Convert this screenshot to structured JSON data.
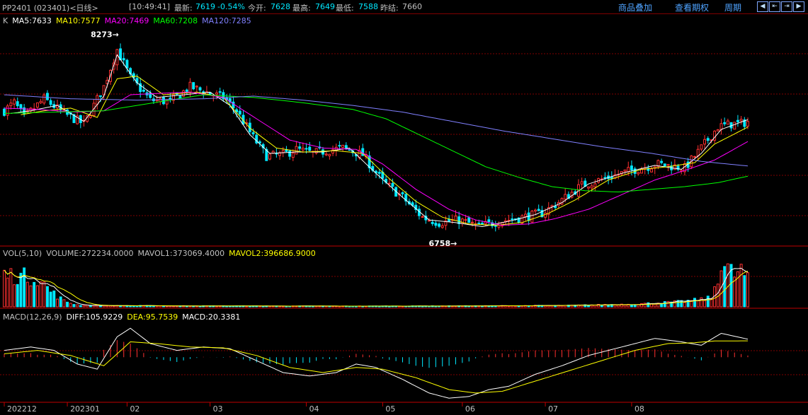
{
  "header": {
    "symbol": "PP2401 (023401)<日线>",
    "time": "[10:49:41]",
    "last_label": "最新:",
    "last_value": "7619",
    "change": "-0.54%",
    "open_label": "今开:",
    "open_value": "7628",
    "high_label": "最高:",
    "high_value": "7649",
    "low_label": "最低:",
    "low_value": "7588",
    "prev_label": "昨结:",
    "prev_value": "7660",
    "buttons": [
      "商品叠加",
      "查看期权",
      "周期"
    ]
  },
  "colors": {
    "up": "#ff3030",
    "down": "#00e8ff",
    "ma5": "#ffffff",
    "ma10": "#ffff00",
    "ma20": "#ff00ff",
    "ma60": "#00ff00",
    "ma120": "#8080ff",
    "grid": "#800000"
  },
  "chart_data": [
    {
      "type": "candlestick",
      "panel": "price",
      "legend": [
        {
          "key": "K",
          "text": "K",
          "color": "#c0c0c0"
        },
        {
          "key": "ma5",
          "text": "MA5:7633",
          "color": "#ffffff"
        },
        {
          "key": "ma10",
          "text": "MA10:7577",
          "color": "#ffff00"
        },
        {
          "key": "ma20",
          "text": "MA20:7469",
          "color": "#ff00ff"
        },
        {
          "key": "ma60",
          "text": "MA60:7208",
          "color": "#00ff00"
        },
        {
          "key": "ma120",
          "text": "MA120:7285",
          "color": "#8080ff"
        }
      ],
      "annotations": [
        {
          "text": "8273",
          "price": 8273
        },
        {
          "text": "6758",
          "price": 6758
        }
      ],
      "ylim": [
        6700,
        8330
      ],
      "close_anchors": [
        [
          0,
          7700
        ],
        [
          3,
          7760
        ],
        [
          6,
          7650
        ],
        [
          12,
          7790
        ],
        [
          18,
          7680
        ],
        [
          24,
          7600
        ],
        [
          30,
          7880
        ],
        [
          34,
          8160
        ],
        [
          38,
          7950
        ],
        [
          44,
          7780
        ],
        [
          50,
          7770
        ],
        [
          56,
          7880
        ],
        [
          62,
          7830
        ],
        [
          66,
          7800
        ],
        [
          70,
          7700
        ],
        [
          75,
          7500
        ],
        [
          79,
          7360
        ],
        [
          84,
          7370
        ],
        [
          88,
          7410
        ],
        [
          93,
          7380
        ],
        [
          97,
          7400
        ],
        [
          102,
          7420
        ],
        [
          108,
          7370
        ],
        [
          114,
          7170
        ],
        [
          120,
          7050
        ],
        [
          126,
          6900
        ],
        [
          131,
          6860
        ],
        [
          137,
          6880
        ],
        [
          143,
          6830
        ],
        [
          149,
          6870
        ],
        [
          156,
          6900
        ],
        [
          162,
          6930
        ],
        [
          168,
          7030
        ],
        [
          174,
          7140
        ],
        [
          182,
          7200
        ],
        [
          190,
          7260
        ],
        [
          197,
          7300
        ],
        [
          205,
          7270
        ],
        [
          210,
          7420
        ],
        [
          215,
          7580
        ],
        [
          219,
          7600
        ],
        [
          222,
          7605
        ],
        [
          224,
          7619
        ]
      ],
      "ma_anchors": {
        "ma5": [
          [
            2,
            7680
          ],
          [
            8,
            7700
          ],
          [
            16,
            7740
          ],
          [
            24,
            7620
          ],
          [
            30,
            7810
          ],
          [
            34,
            8120
          ],
          [
            40,
            7910
          ],
          [
            46,
            7800
          ],
          [
            54,
            7820
          ],
          [
            62,
            7840
          ],
          [
            68,
            7740
          ],
          [
            74,
            7520
          ],
          [
            80,
            7380
          ],
          [
            88,
            7390
          ],
          [
            96,
            7390
          ],
          [
            104,
            7420
          ],
          [
            112,
            7230
          ],
          [
            120,
            7050
          ],
          [
            128,
            6880
          ],
          [
            136,
            6860
          ],
          [
            144,
            6830
          ],
          [
            152,
            6870
          ],
          [
            160,
            6920
          ],
          [
            168,
            7010
          ],
          [
            176,
            7150
          ],
          [
            186,
            7230
          ],
          [
            196,
            7290
          ],
          [
            204,
            7260
          ],
          [
            210,
            7380
          ],
          [
            216,
            7560
          ],
          [
            224,
            7633
          ]
        ],
        "ma10": [
          [
            5,
            7670
          ],
          [
            12,
            7700
          ],
          [
            20,
            7720
          ],
          [
            28,
            7650
          ],
          [
            34,
            7940
          ],
          [
            40,
            7960
          ],
          [
            48,
            7820
          ],
          [
            58,
            7840
          ],
          [
            66,
            7800
          ],
          [
            74,
            7570
          ],
          [
            82,
            7420
          ],
          [
            90,
            7390
          ],
          [
            100,
            7400
          ],
          [
            108,
            7380
          ],
          [
            116,
            7190
          ],
          [
            124,
            7020
          ],
          [
            132,
            6900
          ],
          [
            140,
            6850
          ],
          [
            148,
            6840
          ],
          [
            156,
            6860
          ],
          [
            164,
            6930
          ],
          [
            172,
            7030
          ],
          [
            182,
            7180
          ],
          [
            192,
            7260
          ],
          [
            200,
            7280
          ],
          [
            208,
            7310
          ],
          [
            214,
            7450
          ],
          [
            224,
            7577
          ]
        ],
        "ma20": [
          [
            0,
            7720
          ],
          [
            10,
            7710
          ],
          [
            22,
            7690
          ],
          [
            30,
            7700
          ],
          [
            38,
            7820
          ],
          [
            46,
            7830
          ],
          [
            56,
            7840
          ],
          [
            66,
            7800
          ],
          [
            76,
            7640
          ],
          [
            86,
            7480
          ],
          [
            96,
            7420
          ],
          [
            106,
            7410
          ],
          [
            114,
            7300
          ],
          [
            124,
            7110
          ],
          [
            134,
            6960
          ],
          [
            142,
            6880
          ],
          [
            150,
            6840
          ],
          [
            158,
            6850
          ],
          [
            166,
            6890
          ],
          [
            176,
            6960
          ],
          [
            186,
            7070
          ],
          [
            196,
            7180
          ],
          [
            206,
            7260
          ],
          [
            214,
            7330
          ],
          [
            224,
            7469
          ]
        ],
        "ma60": [
          [
            0,
            7680
          ],
          [
            15,
            7690
          ],
          [
            30,
            7700
          ],
          [
            45,
            7760
          ],
          [
            60,
            7820
          ],
          [
            75,
            7800
          ],
          [
            90,
            7760
          ],
          [
            105,
            7710
          ],
          [
            115,
            7640
          ],
          [
            125,
            7520
          ],
          [
            135,
            7400
          ],
          [
            145,
            7280
          ],
          [
            155,
            7200
          ],
          [
            165,
            7130
          ],
          [
            175,
            7100
          ],
          [
            185,
            7090
          ],
          [
            195,
            7110
          ],
          [
            205,
            7130
          ],
          [
            215,
            7160
          ],
          [
            224,
            7208
          ]
        ],
        "ma120": [
          [
            0,
            7820
          ],
          [
            20,
            7790
          ],
          [
            40,
            7780
          ],
          [
            60,
            7790
          ],
          [
            75,
            7810
          ],
          [
            90,
            7780
          ],
          [
            105,
            7740
          ],
          [
            120,
            7690
          ],
          [
            135,
            7620
          ],
          [
            150,
            7550
          ],
          [
            165,
            7490
          ],
          [
            180,
            7430
          ],
          [
            195,
            7380
          ],
          [
            210,
            7320
          ],
          [
            224,
            7285
          ]
        ]
      },
      "count": 225
    },
    {
      "type": "bar",
      "panel": "volume",
      "legend": [
        {
          "key": "vol",
          "text": "VOL(5,10)",
          "color": "#c0c0c0"
        },
        {
          "key": "volume",
          "text": "VOLUME:272234.0000",
          "color": "#c0c0c0"
        },
        {
          "key": "mavol1",
          "text": "MAVOL1:373069.4000",
          "color": "#c0c0c0"
        },
        {
          "key": "mavol2",
          "text": "MAVOL2:396686.9000",
          "color": "#ffff00"
        }
      ],
      "ylim": [
        0,
        500000
      ],
      "vol_anchors": [
        [
          0,
          330000
        ],
        [
          6,
          310000
        ],
        [
          10,
          300000
        ],
        [
          14,
          160000
        ],
        [
          18,
          60000
        ],
        [
          22,
          20000
        ],
        [
          30,
          12000
        ],
        [
          60,
          9000
        ],
        [
          100,
          7000
        ],
        [
          140,
          9000
        ],
        [
          170,
          14000
        ],
        [
          190,
          28000
        ],
        [
          205,
          55000
        ],
        [
          213,
          90000
        ],
        [
          216,
          440000
        ],
        [
          220,
          330000
        ],
        [
          222,
          370000
        ],
        [
          224,
          272234
        ]
      ]
    },
    {
      "type": "line",
      "panel": "macd",
      "legend": [
        {
          "key": "macd",
          "text": "MACD(12,26,9)",
          "color": "#c0c0c0"
        },
        {
          "key": "diff",
          "text": "DIFF:105.9229",
          "color": "#ffffff"
        },
        {
          "key": "dea",
          "text": "DEA:95.7539",
          "color": "#ffff00"
        },
        {
          "key": "macdv",
          "text": "MACD:20.3381",
          "color": "#ffffff"
        }
      ],
      "ylim": [
        -260,
        200
      ],
      "diff_anchors": [
        [
          0,
          40
        ],
        [
          8,
          60
        ],
        [
          15,
          40
        ],
        [
          22,
          -40
        ],
        [
          28,
          -70
        ],
        [
          34,
          120
        ],
        [
          38,
          170
        ],
        [
          44,
          80
        ],
        [
          52,
          40
        ],
        [
          60,
          60
        ],
        [
          68,
          50
        ],
        [
          76,
          -20
        ],
        [
          84,
          -90
        ],
        [
          92,
          -110
        ],
        [
          100,
          -90
        ],
        [
          106,
          -40
        ],
        [
          112,
          -60
        ],
        [
          120,
          -130
        ],
        [
          128,
          -210
        ],
        [
          134,
          -240
        ],
        [
          140,
          -230
        ],
        [
          146,
          -190
        ],
        [
          152,
          -170
        ],
        [
          160,
          -100
        ],
        [
          168,
          -50
        ],
        [
          176,
          10
        ],
        [
          186,
          60
        ],
        [
          196,
          110
        ],
        [
          204,
          90
        ],
        [
          210,
          70
        ],
        [
          216,
          140
        ],
        [
          224,
          106
        ]
      ],
      "dea_anchors": [
        [
          0,
          20
        ],
        [
          10,
          40
        ],
        [
          20,
          10
        ],
        [
          30,
          -50
        ],
        [
          38,
          90
        ],
        [
          46,
          80
        ],
        [
          56,
          60
        ],
        [
          66,
          55
        ],
        [
          76,
          10
        ],
        [
          86,
          -60
        ],
        [
          96,
          -90
        ],
        [
          106,
          -60
        ],
        [
          114,
          -70
        ],
        [
          124,
          -120
        ],
        [
          134,
          -190
        ],
        [
          142,
          -210
        ],
        [
          150,
          -200
        ],
        [
          160,
          -140
        ],
        [
          170,
          -80
        ],
        [
          180,
          -20
        ],
        [
          190,
          40
        ],
        [
          200,
          80
        ],
        [
          208,
          85
        ],
        [
          214,
          95
        ],
        [
          224,
          96
        ]
      ],
      "xticks": [
        {
          "index": 0,
          "label": "202212"
        },
        {
          "index": 19,
          "label": "202301"
        },
        {
          "index": 37,
          "label": "02"
        },
        {
          "index": 62,
          "label": "03"
        },
        {
          "index": 91,
          "label": "04"
        },
        {
          "index": 114,
          "label": "05"
        },
        {
          "index": 138,
          "label": "06"
        },
        {
          "index": 163,
          "label": "07"
        },
        {
          "index": 189,
          "label": "08"
        }
      ]
    }
  ]
}
